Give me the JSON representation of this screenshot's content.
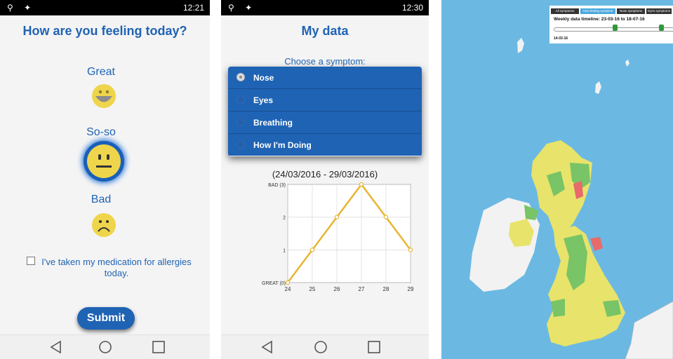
{
  "screen1": {
    "status_time": "12:21",
    "title": "How are you feeling today?",
    "feelings": [
      {
        "label": "Great",
        "face": "big-smile-face-icon"
      },
      {
        "label": "So-so",
        "face": "neutral-face-icon",
        "selected": true
      },
      {
        "label": "Bad",
        "face": "frown-face-icon"
      }
    ],
    "medication_text": "I've taken my medication for allergies today.",
    "submit_label": "Submit"
  },
  "screen2": {
    "status_time": "12:30",
    "title": "My data",
    "choose_label": "Choose a symptom:",
    "symptoms": [
      {
        "label": "Nose",
        "selected": true
      },
      {
        "label": "Eyes",
        "selected": false
      },
      {
        "label": "Breathing",
        "selected": false
      },
      {
        "label": "How I'm Doing",
        "selected": false
      }
    ],
    "chart_title": "(24/03/2016 - 29/03/2016)"
  },
  "chart_data": {
    "type": "line",
    "title": "(24/03/2016 - 29/03/2016)",
    "x": [
      24,
      25,
      26,
      27,
      28,
      29
    ],
    "values": [
      0,
      1,
      2,
      3,
      2,
      1
    ],
    "ylim": [
      0,
      3
    ],
    "y_tick_labels": [
      "GREAT (0)",
      "1",
      "2",
      "BAD (3)"
    ],
    "grid": true,
    "line_color": "#e8b531"
  },
  "screen3": {
    "tabs": [
      "All symptoms",
      "How feeling symptom",
      "Nose symptoms",
      "Eyes symptoms"
    ],
    "active_tab": 1,
    "timeline_label": "Weekly data timeline: 23-03-16 to 18-07-16",
    "date_left": "14-03-16",
    "colors": {
      "sea": "#6bb9e3",
      "land_neutral": "#f2f2f2",
      "yellow": "#e8e36a",
      "green": "#78c466",
      "red": "#e96a6a",
      "tab_active": "#4aa8dd",
      "tab_dark": "#333333",
      "handle": "#2f9a3c"
    }
  },
  "nav": {
    "back_icon": "back-triangle-icon",
    "home_icon": "home-circle-icon",
    "recent_icon": "recent-square-icon"
  }
}
